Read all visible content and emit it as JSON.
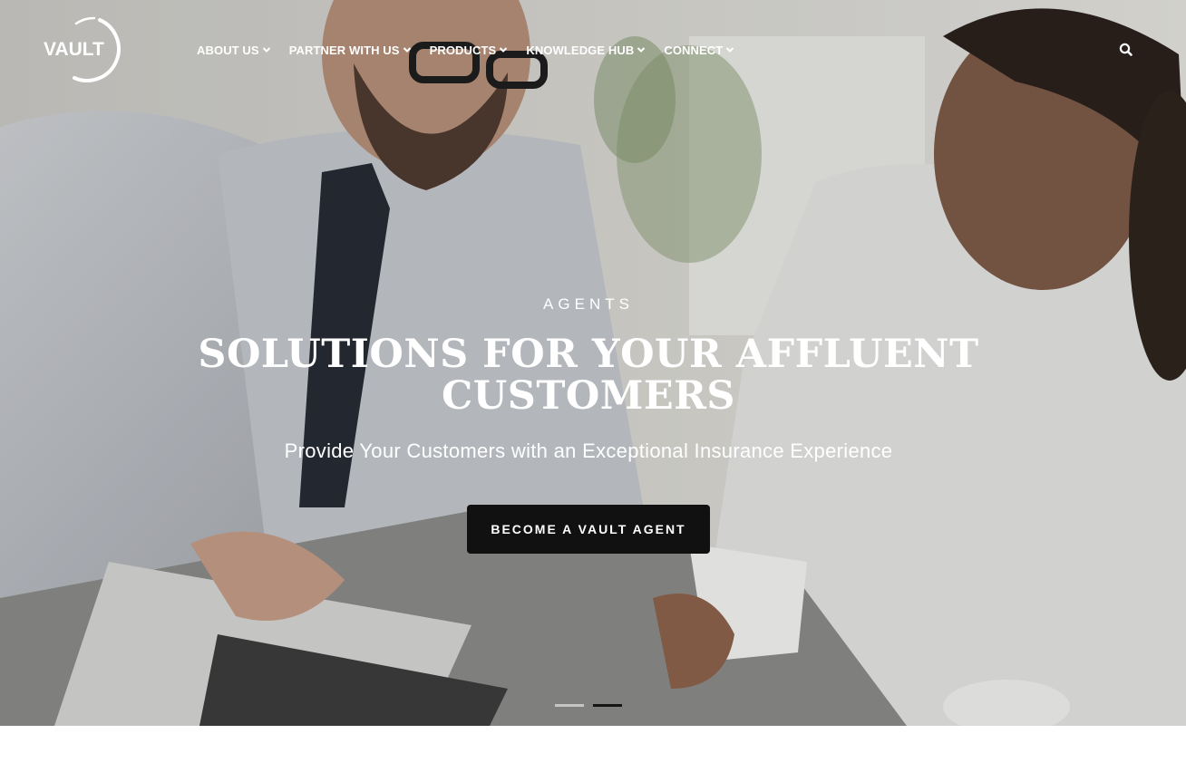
{
  "brand": {
    "logo_text": "VAULT",
    "logo_color": "#ffffff"
  },
  "nav": {
    "items": [
      {
        "label": "ABOUT US"
      },
      {
        "label": "PARTNER WITH US"
      },
      {
        "label": "PRODUCTS"
      },
      {
        "label": "KNOWLEDGE HUB"
      },
      {
        "label": "CONNECT"
      }
    ],
    "search_icon": "search-icon",
    "dropdown_icon": "chevron-down-icon"
  },
  "hero": {
    "eyebrow": "AGENTS",
    "headline": "SOLUTIONS FOR YOUR AFFLUENT CUSTOMERS",
    "subheadline": "Provide Your Customers with an Exceptional Insurance Experience",
    "cta_label": "BECOME A VAULT AGENT",
    "slides_total": 2,
    "active_slide": 2
  },
  "colors": {
    "text": "#ffffff",
    "cta_background": "#111111",
    "active_indicator": "#151515"
  }
}
